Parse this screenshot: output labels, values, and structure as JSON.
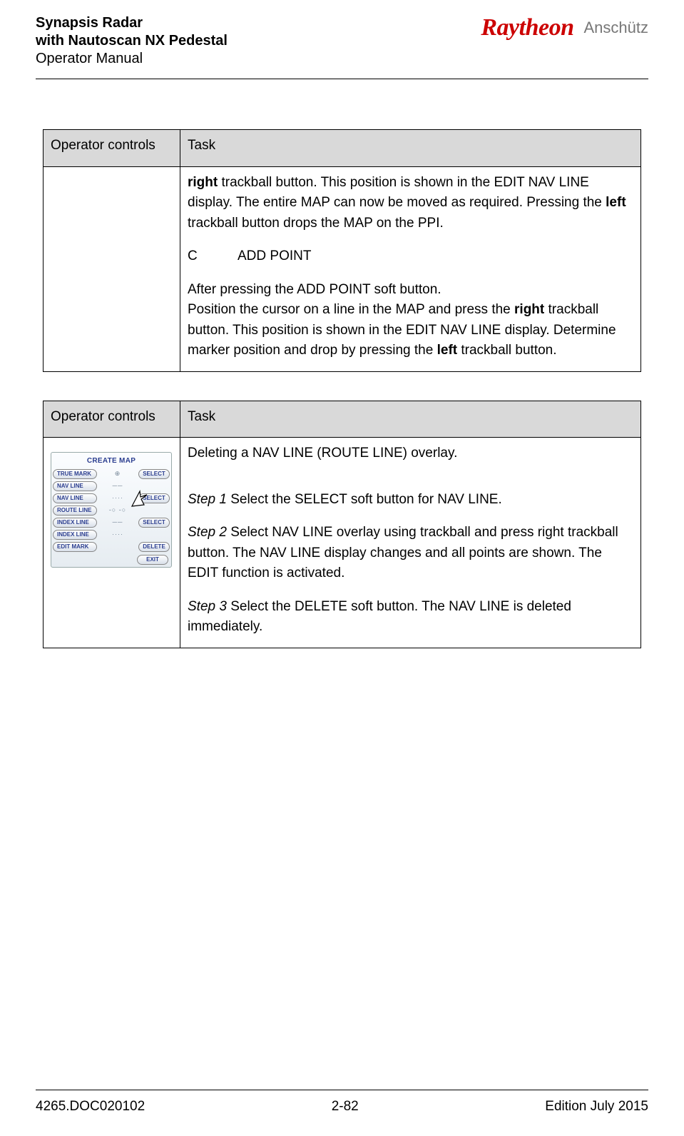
{
  "header": {
    "line1": "Synapsis Radar",
    "line2": "with Nautoscan NX Pedestal",
    "line3": "Operator Manual",
    "logo_main": "Raytheon",
    "logo_sub": "Anschütz"
  },
  "table1": {
    "h1": "Operator controls",
    "h2": "Task",
    "para1_a": "right",
    "para1_b": " trackball button. This position is shown in the EDIT NAV LINE display. The entire MAP can now be moved as required. Pressing the ",
    "para1_c": "left",
    "para1_d": " trackball button drops the MAP on the PPI.",
    "sub_c": "C",
    "sub_c_label": "ADD POINT",
    "para2_a": "After pressing the ADD POINT soft button.",
    "para2_b": "Position the cursor on a line in the MAP and press the ",
    "para2_c": "right",
    "para2_d": " trackball button. This position is shown in the EDIT NAV LINE display. Determine marker position and drop by pressing the ",
    "para2_e": "left",
    "para2_f": " trackball button."
  },
  "table2": {
    "h1": "Operator controls",
    "h2": "Task",
    "intro": "Deleting a NAV LINE (ROUTE LINE) overlay.",
    "s1_lbl": "Step 1",
    "s1_txt": " Select the SELECT soft button for NAV LINE.",
    "s2_lbl": "Step 2",
    "s2_txt": " Select NAV LINE overlay using trackball and press right trackball button. The NAV LINE display changes and all points are shown. The EDIT function is activated.",
    "s3_lbl": "Step 3",
    "s3_txt": " Select the DELETE soft button. The NAV LINE is deleted immediately."
  },
  "panel": {
    "title": "CREATE MAP",
    "rows": [
      {
        "l": "TRUE MARK",
        "m": "⊕",
        "r": "SELECT"
      },
      {
        "l": "NAV LINE",
        "m": "──",
        "r": ""
      },
      {
        "l": "NAV LINE",
        "m": "····",
        "r": "SELECT"
      },
      {
        "l": "ROUTE LINE",
        "m": "-○ -○",
        "r": ""
      },
      {
        "l": "INDEX LINE",
        "m": "──",
        "r": "SELECT"
      },
      {
        "l": "INDEX LINE",
        "m": "····",
        "r": ""
      },
      {
        "l": "EDIT MARK",
        "m": "",
        "r": "DELETE"
      }
    ],
    "exit": "EXIT"
  },
  "footer": {
    "left": "4265.DOC020102",
    "center": "2-82",
    "right": "Edition July 2015"
  }
}
